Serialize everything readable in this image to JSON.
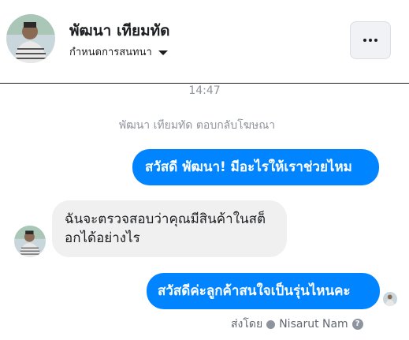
{
  "header": {
    "name": "พัฒนา เทียมทัด",
    "subtitle": "กำหนดการสนทนา",
    "more_icon": "more-dots-icon"
  },
  "conversation": {
    "timestamp": "14:47",
    "system_note": "พัฒนา เทียมทัด ตอบกลับโฆษณา",
    "messages": [
      {
        "direction": "outgoing",
        "text": "สวัสดี พัฒนา! มีอะไรให้เราช่วยไหม"
      },
      {
        "direction": "incoming",
        "text": "ฉันจะตรวจสอบว่าคุณมีสินค้าในสต็อกได้อย่างไร"
      },
      {
        "direction": "outgoing",
        "text": "สวัสดีค่ะลูกค้าสนใจเป็นรุ่นไหนคะ"
      }
    ],
    "sent_by_label": "ส่งโดย",
    "sent_by_name": "Nisarut Nam"
  },
  "colors": {
    "outgoing_bubble": "#0084ff",
    "incoming_bubble": "#f0f0f0",
    "meta_text": "#90949c"
  }
}
